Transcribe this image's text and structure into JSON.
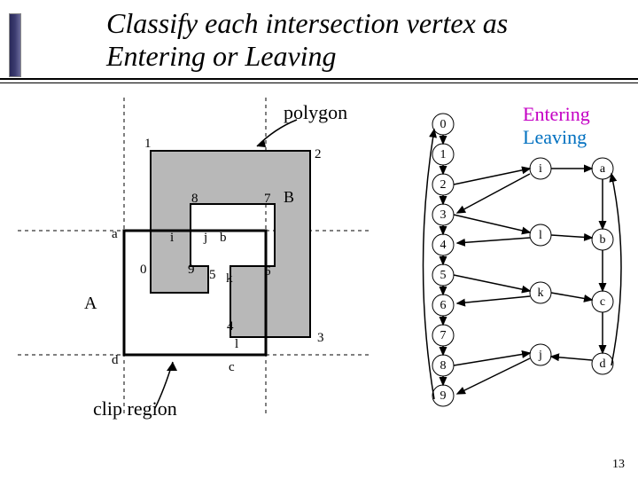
{
  "title_line1": "Classify each intersection vertex as",
  "title_line2": "Entering or Leaving",
  "labels": {
    "polygon": "polygon",
    "clip_region": "clip region",
    "entering": "Entering",
    "leaving": "Leaving",
    "A": "A",
    "B": "B"
  },
  "polygon_vertices": [
    "0",
    "1",
    "2",
    "3",
    "4",
    "5",
    "6",
    "7",
    "8",
    "9"
  ],
  "clip_vertices": [
    "a",
    "b",
    "c",
    "d"
  ],
  "intersections": [
    "i",
    "j",
    "k",
    "l"
  ],
  "left_chain": [
    "0",
    "1",
    "2",
    "3",
    "4",
    "5",
    "6",
    "7",
    "8",
    "9"
  ],
  "right_chain": [
    "i",
    "a",
    "b",
    "k",
    "c",
    "l",
    "d",
    "j"
  ],
  "right_roles": {
    "i": "enter",
    "a": "",
    "b": "",
    "k": "enter",
    "c": "",
    "l": "leave",
    "d": "",
    "j": "leave"
  },
  "page_number": "13"
}
